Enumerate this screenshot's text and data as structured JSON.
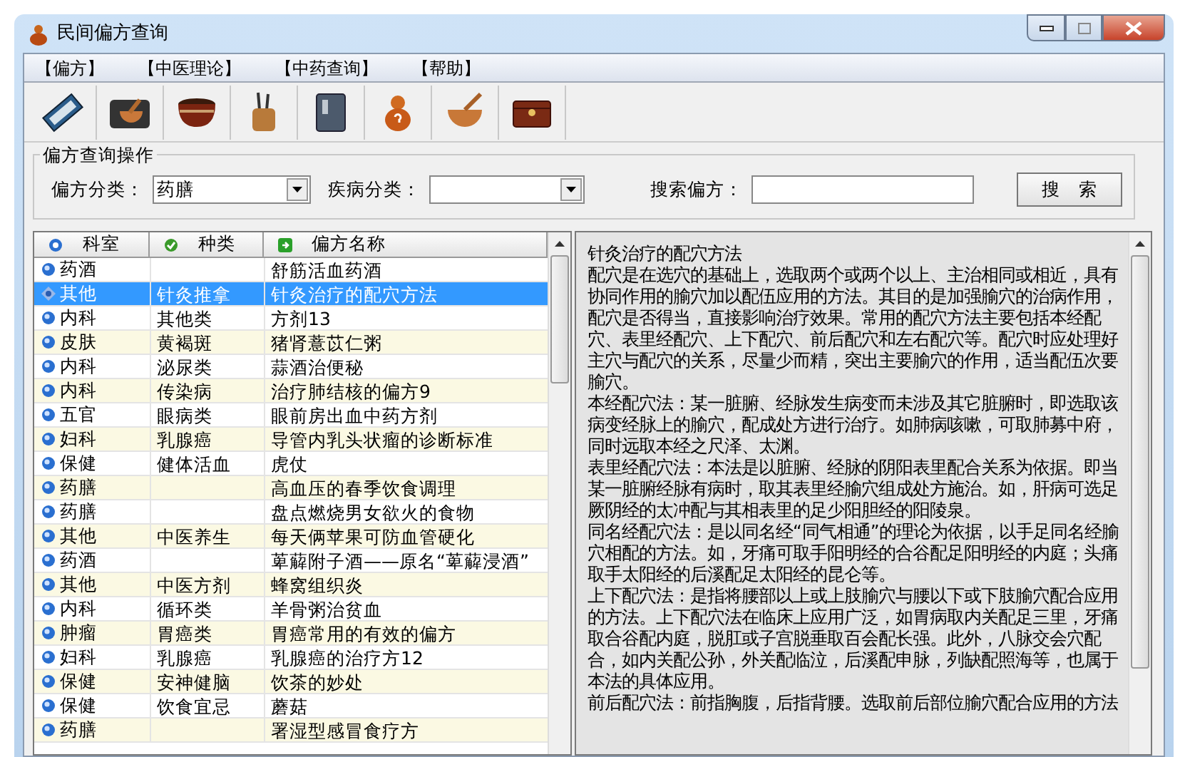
{
  "window": {
    "title": "民间偏方查询"
  },
  "menu": [
    {
      "label": "【偏方】"
    },
    {
      "label": "【中医理论】"
    },
    {
      "label": "【中药查询】"
    },
    {
      "label": "【帮助】"
    }
  ],
  "query": {
    "title": "偏方查询操作",
    "category_label": "偏方分类：",
    "category_value": "药膳",
    "disease_label": "疾病分类：",
    "search_label": "搜索偏方：",
    "search_button": "搜　索"
  },
  "table": {
    "columns": [
      "科室",
      "种类",
      "偏方名称"
    ],
    "rows": [
      {
        "cells": [
          "药酒",
          "",
          "舒筋活血药酒"
        ],
        "selected": false
      },
      {
        "cells": [
          "其他",
          "针灸推拿",
          "针灸治疗的配穴方法"
        ],
        "selected": true
      },
      {
        "cells": [
          "内科",
          "其他类",
          "方剂13"
        ],
        "selected": false
      },
      {
        "cells": [
          "皮肤",
          "黄褐斑",
          "猪肾薏苡仁粥"
        ],
        "selected": false
      },
      {
        "cells": [
          "内科",
          "泌尿类",
          "蒜酒治便秘"
        ],
        "selected": false
      },
      {
        "cells": [
          "内科",
          "传染病",
          "治疗肺结核的偏方9"
        ],
        "selected": false
      },
      {
        "cells": [
          "五官",
          "眼病类",
          "眼前房出血中药方剂"
        ],
        "selected": false
      },
      {
        "cells": [
          "妇科",
          "乳腺癌",
          "导管内乳头状瘤的诊断标准"
        ],
        "selected": false
      },
      {
        "cells": [
          "保健",
          "健体活血",
          "虎仗"
        ],
        "selected": false
      },
      {
        "cells": [
          "药膳",
          "",
          "高血压的春季饮食调理"
        ],
        "selected": false
      },
      {
        "cells": [
          "药膳",
          "",
          "盘点燃烧男女欲火的食物"
        ],
        "selected": false
      },
      {
        "cells": [
          "其他",
          "中医养生",
          "每天俩苹果可防血管硬化"
        ],
        "selected": false
      },
      {
        "cells": [
          "药酒",
          "",
          "萆薢附子酒——原名“萆薢浸酒”"
        ],
        "selected": false
      },
      {
        "cells": [
          "其他",
          "中医方剂",
          "蜂窝组织炎"
        ],
        "selected": false
      },
      {
        "cells": [
          "内科",
          "循环类",
          "羊骨粥治贫血"
        ],
        "selected": false
      },
      {
        "cells": [
          "肿瘤",
          "胃癌类",
          "胃癌常用的有效的偏方"
        ],
        "selected": false
      },
      {
        "cells": [
          "妇科",
          "乳腺癌",
          "乳腺癌的治疗方12"
        ],
        "selected": false
      },
      {
        "cells": [
          "保健",
          "安神健脑",
          "饮茶的妙处"
        ],
        "selected": false
      },
      {
        "cells": [
          "保健",
          "饮食宜忌",
          "蘑菇"
        ],
        "selected": false
      },
      {
        "cells": [
          "药膳",
          "",
          "署湿型感冒食疗方"
        ],
        "selected": false
      }
    ]
  },
  "detail": {
    "title": "针灸治疗的配穴方法",
    "paragraphs": [
      "配穴是在选穴的基础上，选取两个或两个以上、主治相同或相近，具有协同作用的腧穴加以配伍应用的方法。其目的是加强腧穴的治病作用，配穴是否得当，直接影响治疗效果。常用的配穴方法主要包括本经配穴、表里经配穴、上下配穴、前后配穴和左右配穴等。配穴时应处理好主穴与配穴的关系，尽量少而精，突出主要腧穴的作用，适当配伍次要腧穴。",
      "本经配穴法：某一脏腑、经脉发生病变而未涉及其它脏腑时，即选取该病变经脉上的腧穴，配成处方进行治疗。如肺病咳嗽，可取肺募中府，同时远取本经之尺泽、太渊。",
      "表里经配穴法：本法是以脏腑、经脉的阴阳表里配合关系为依据。即当某一脏腑经脉有病时，取其表里经腧穴组成处方施治。如，肝病可选足厥阴经的太冲配与其相表里的足少阳胆经的阳陵泉。",
      "同名经配穴法：是以同名经“同气相通”的理论为依据，以手足同名经腧穴相配的方法。如，牙痛可取手阳明经的合谷配足阳明经的内庭；头痛取手太阳经的后溪配足太阳经的昆仑等。",
      "上下配穴法：是指将腰部以上或上肢腧穴与腰以下或下肢腧穴配合应用的方法。上下配穴法在临床上应用广泛，如胃病取内关配足三里，牙痛取合谷配内庭，脱肛或子宫脱垂取百会配长强。此外，八脉交会穴配合，如内关配公孙，外关配临泣，后溪配申脉，列缺配照海等，也属于本法的具体应用。",
      "前后配穴法：前指胸腹，后指背腰。选取前后部位腧穴配合应用的方法"
    ]
  }
}
